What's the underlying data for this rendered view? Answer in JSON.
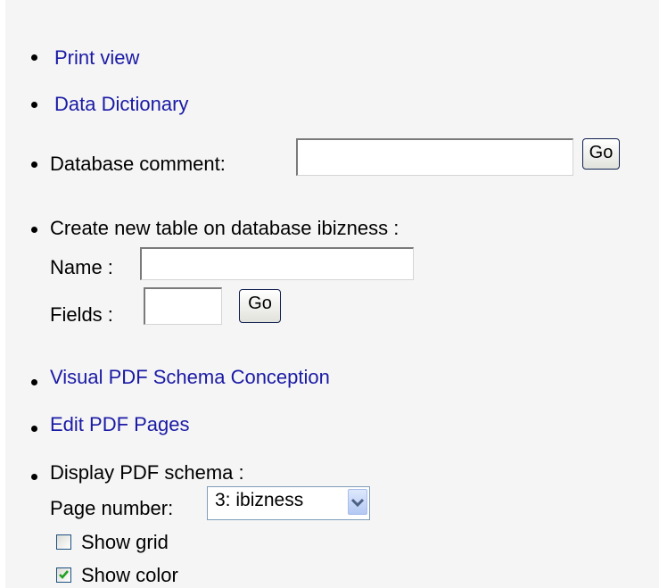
{
  "links": {
    "print_view": "Print view",
    "data_dictionary": "Data Dictionary",
    "visual_pdf": "Visual PDF Schema Conception",
    "edit_pdf": "Edit PDF Pages"
  },
  "db_comment": {
    "label": "Database comment:",
    "value": "",
    "go_label": "Go"
  },
  "create_table": {
    "heading": "Create new table on database ibizness :",
    "name_label": "Name :",
    "name_value": "",
    "fields_label": "Fields :",
    "fields_value": "",
    "go_label": "Go"
  },
  "pdf_schema": {
    "heading": "Display PDF schema :",
    "page_label": "Page number:",
    "page_selected": "3: ibizness",
    "show_grid_label": "Show grid",
    "show_grid_checked": false,
    "show_color_label": "Show color",
    "show_color_checked": true
  },
  "colors": {
    "link": "#1a1aa6",
    "panel_bg": "#f5f5f5",
    "check_green": "#21a121"
  }
}
